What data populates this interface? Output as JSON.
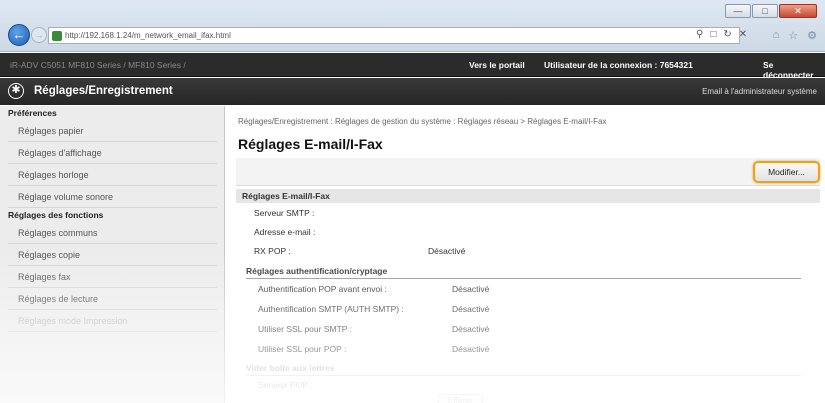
{
  "browser": {
    "url": "http://192.168.1.24/m_network_email_ifax.html",
    "window_buttons": [
      "—",
      "□",
      "✕"
    ]
  },
  "topbar": {
    "device": "iR-ADV C5051   MF810 Series / MF810 Series /",
    "portal": "Vers le portail",
    "user_label": "Utilisateur de la connexion :  7654321",
    "logout": "Se déconnecter"
  },
  "titlebar": {
    "title": "Réglages/Enregistrement",
    "mail_admin": "Email à l'administrateur système"
  },
  "sidebar": {
    "section1": "Préférences",
    "items1": [
      "Réglages papier",
      "Réglages d'affichage",
      "Réglages horloge",
      "Réglage volume sonore"
    ],
    "section2": "Réglages des fonctions",
    "items2": [
      "Réglages communs",
      "Réglages copie",
      "Réglages fax",
      "Réglages de lecture",
      "Réglages mode Impression"
    ]
  },
  "main": {
    "breadcrumb": "Réglages/Enregistrement : Réglages de gestion du système : Réglages réseau > Réglages E-mail/I-Fax",
    "heading": "Réglages E-mail/I-Fax",
    "modify_button": "Modifier...",
    "section_title": "Réglages E-mail/I-Fax",
    "rows1": [
      {
        "label": "Serveur SMTP :",
        "value": ""
      },
      {
        "label": "Adresse e-mail :",
        "value": ""
      },
      {
        "label": "RX POP :",
        "value": "Désactivé"
      }
    ],
    "auth_title": "Réglages authentification/cryptage",
    "rows2": [
      {
        "label": "Authentification POP avant envoi :",
        "value": "Désactivé"
      },
      {
        "label": "Authentification SMTP (AUTH SMTP) :",
        "value": "Désactivé"
      },
      {
        "label": "Utiliser SSL pour SMTP :",
        "value": "Désactivé"
      },
      {
        "label": "Utiliser SSL pour POP :",
        "value": "Désactivé"
      }
    ],
    "clear_title": "Vider boîte aux lettres",
    "clear_row": "Serveur POP :",
    "clear_button": "Effacer"
  }
}
